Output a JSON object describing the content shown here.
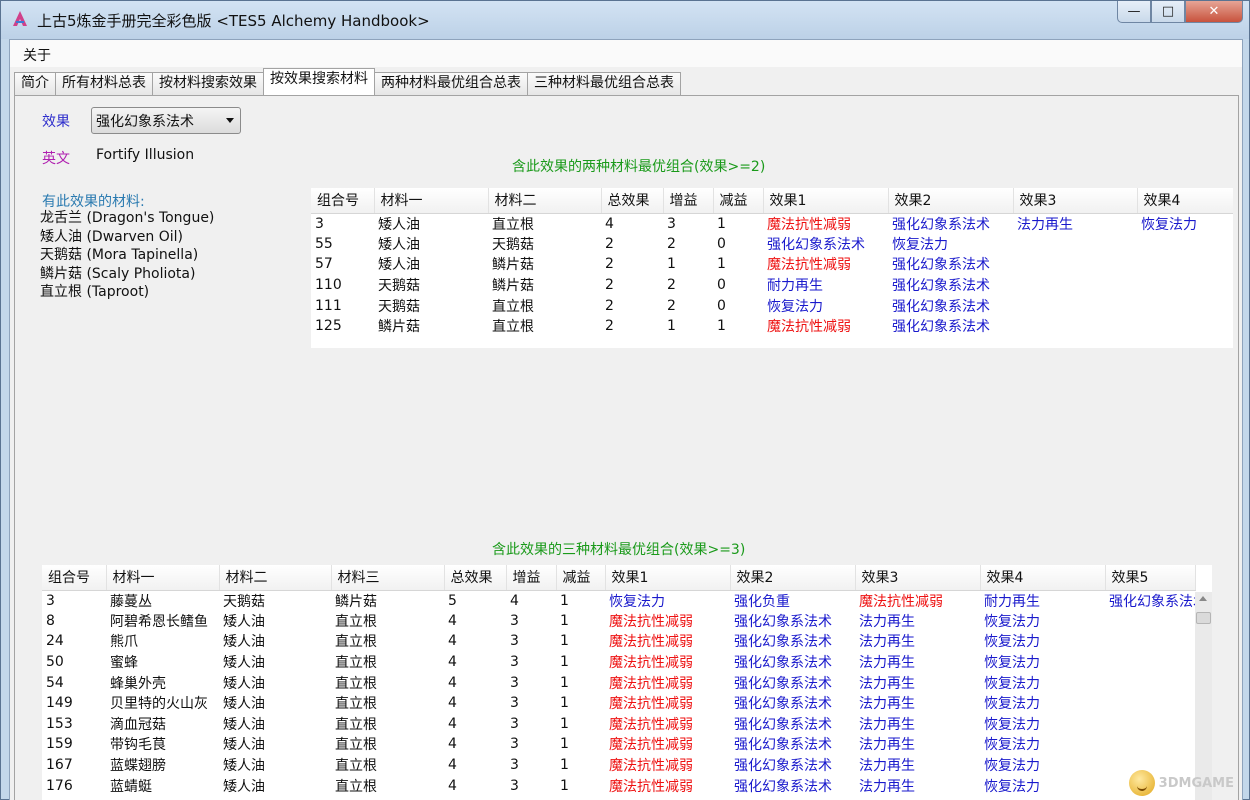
{
  "window": {
    "title": "上古5炼金手册完全彩色版   <TES5 Alchemy Handbook>",
    "minimize": "—",
    "maximize": "□",
    "close": "✕"
  },
  "menubar": {
    "about": "关于"
  },
  "tabs": [
    "简介",
    "所有材料总表",
    "按材料搜索效果",
    "按效果搜索材料",
    "两种材料最优组合总表",
    "三种材料最优组合总表"
  ],
  "active_tab": 3,
  "effect_panel": {
    "effect_label": "效果",
    "effect_value": "强化幻象系法术",
    "english_label": "英文",
    "english_value": "Fortify Illusion",
    "materials_heading": "有此效果的材料:",
    "materials": [
      "龙舌兰  (Dragon's Tongue)",
      "矮人油  (Dwarven Oil)",
      "天鹅菇  (Mora Tapinella)",
      "鳞片菇  (Scaly Pholiota)",
      "直立根  (Taproot)"
    ]
  },
  "colors": {
    "beneficial": "#1919cc",
    "harmful": "#ee1111",
    "heading": "#1a9a1a"
  },
  "two_table": {
    "caption": "含此效果的两种材料最优组合(效果>=2)",
    "headers": [
      "组合号",
      "材料一",
      "材料二",
      "总效果",
      "增益",
      "减益",
      "效果1",
      "效果2",
      "效果3",
      "效果4"
    ],
    "rows": [
      [
        "3",
        "矮人油",
        "直立根",
        "4",
        "3",
        "1",
        "魔法抗性减弱",
        "强化幻象系法术",
        "法力再生",
        "恢复法力"
      ],
      [
        "55",
        "矮人油",
        "天鹅菇",
        "2",
        "2",
        "0",
        "强化幻象系法术",
        "恢复法力",
        "",
        ""
      ],
      [
        "57",
        "矮人油",
        "鳞片菇",
        "2",
        "1",
        "1",
        "魔法抗性减弱",
        "强化幻象系法术",
        "",
        ""
      ],
      [
        "110",
        "天鹅菇",
        "鳞片菇",
        "2",
        "2",
        "0",
        "耐力再生",
        "强化幻象系法术",
        "",
        ""
      ],
      [
        "111",
        "天鹅菇",
        "直立根",
        "2",
        "2",
        "0",
        "恢复法力",
        "强化幻象系法术",
        "",
        ""
      ],
      [
        "125",
        "鳞片菇",
        "直立根",
        "2",
        "1",
        "1",
        "魔法抗性减弱",
        "强化幻象系法术",
        "",
        ""
      ]
    ]
  },
  "three_table": {
    "caption": "含此效果的三种材料最优组合(效果>=3)",
    "headers": [
      "组合号",
      "材料一",
      "材料二",
      "材料三",
      "总效果",
      "增益",
      "减益",
      "效果1",
      "效果2",
      "效果3",
      "效果4",
      "效果5"
    ],
    "rows": [
      [
        "3",
        "藤蔓丛",
        "天鹅菇",
        "鳞片菇",
        "5",
        "4",
        "1",
        "恢复法力",
        "强化负重",
        "魔法抗性减弱",
        "耐力再生",
        "强化幻象系法术"
      ],
      [
        "8",
        "阿碧希恩长鳍鱼",
        "矮人油",
        "直立根",
        "4",
        "3",
        "1",
        "魔法抗性减弱",
        "强化幻象系法术",
        "法力再生",
        "恢复法力",
        ""
      ],
      [
        "24",
        "熊爪",
        "矮人油",
        "直立根",
        "4",
        "3",
        "1",
        "魔法抗性减弱",
        "强化幻象系法术",
        "法力再生",
        "恢复法力",
        ""
      ],
      [
        "50",
        "蜜蜂",
        "矮人油",
        "直立根",
        "4",
        "3",
        "1",
        "魔法抗性减弱",
        "强化幻象系法术",
        "法力再生",
        "恢复法力",
        ""
      ],
      [
        "54",
        "蜂巢外壳",
        "矮人油",
        "直立根",
        "4",
        "3",
        "1",
        "魔法抗性减弱",
        "强化幻象系法术",
        "法力再生",
        "恢复法力",
        ""
      ],
      [
        "149",
        "贝里特的火山灰",
        "矮人油",
        "直立根",
        "4",
        "3",
        "1",
        "魔法抗性减弱",
        "强化幻象系法术",
        "法力再生",
        "恢复法力",
        ""
      ],
      [
        "153",
        "滴血冠菇",
        "矮人油",
        "直立根",
        "4",
        "3",
        "1",
        "魔法抗性减弱",
        "强化幻象系法术",
        "法力再生",
        "恢复法力",
        ""
      ],
      [
        "159",
        "带钩毛茛",
        "矮人油",
        "直立根",
        "4",
        "3",
        "1",
        "魔法抗性减弱",
        "强化幻象系法术",
        "法力再生",
        "恢复法力",
        ""
      ],
      [
        "167",
        "蓝蝶翅膀",
        "矮人油",
        "直立根",
        "4",
        "3",
        "1",
        "魔法抗性减弱",
        "强化幻象系法术",
        "法力再生",
        "恢复法力",
        ""
      ],
      [
        "176",
        "蓝蜻蜓",
        "矮人油",
        "直立根",
        "4",
        "3",
        "1",
        "魔法抗性减弱",
        "强化幻象系法术",
        "法力再生",
        "恢复法力",
        ""
      ]
    ]
  },
  "harmful_effects": [
    "魔法抗性减弱"
  ],
  "watermark": "3DMGAME"
}
